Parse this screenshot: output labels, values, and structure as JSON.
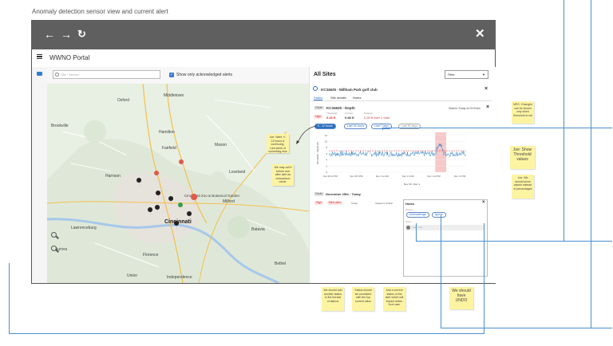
{
  "caption": "Anomaly detection sensor view and current alert",
  "app": {
    "title": "WWNO Portal"
  },
  "search": {
    "placeholder": "Site / Sensor",
    "show_ack_label": "Show only acknowledged alerts"
  },
  "map": {
    "labels": {
      "middletown": "Middletown",
      "oxford": "Oxford",
      "brookville": "Brookville",
      "hamilton": "Hamilton",
      "fairfield": "Fairfield",
      "mason": "Mason",
      "harrison": "Harrison",
      "loveland": "Loveland",
      "milford": "Milford",
      "cincinnati": "Cincinnati",
      "zoo": "Cincinnati Zoo &\nBotanical Garden",
      "lawrenceburg": "Lawrenceburg",
      "batavia": "Batavia",
      "florence": "Florence",
      "bethel": "Bethel",
      "union": "Union",
      "independence": "Independence",
      "aurora": "Aurora"
    }
  },
  "panel": {
    "title": "All Sites",
    "filter": "Filter",
    "site_name": "KC34625 - Millham Park golf club",
    "tabs": [
      "Status",
      "Site details",
      "Notes"
    ],
    "sensor_tag": "Depth",
    "sensor_name": "KC34625 - Depth",
    "started": "Started Today at 09:00am",
    "level_badge": "High",
    "threshold_label": "Threshold",
    "threshold_value": "0.43 ft",
    "current_label": "Current",
    "current_value": "0.68 ft",
    "change_label": "Change",
    "change_value": "0.25 ft over 1 hour",
    "ranges": [
      "6 - 12 hours",
      "Last 24 hours",
      "Last 7 days",
      "Last 30 days"
    ],
    "alert_tag": "Depth",
    "alert_date": "November 25th - Today",
    "alert_badge_high": "High",
    "alert_badge_new": "New alert",
    "alert_when": "Today",
    "alert_status": "Viewed in Portal"
  },
  "notes_panel": {
    "title": "Notes",
    "actions_label": "Actions",
    "ack_button": "Acknowledge",
    "ignore_button": "Ignore",
    "notes_label": "Notes",
    "add_note_placeholder": "Add note..."
  },
  "chart_data": {
    "type": "line",
    "ylabel": "KC34625 - Depth (ft)",
    "xlabel": "Nov 30 - Dec 1",
    "y_ticks": [
      "12",
      "10",
      "8",
      "6",
      "4",
      "2",
      "0"
    ],
    "x_ticks": [
      "Nov 30 12 PM",
      "Nov 30 6 PM",
      "Dec 1 12 AM",
      "Dec 1 6 AM",
      "Dec 1 12 PM",
      "Dec 1 6 PM"
    ],
    "ylim": [
      0,
      13
    ],
    "threshold": 7,
    "highlight_start": 0.775,
    "highlight_end": 0.855,
    "baseline": 6,
    "noise": 0.9,
    "spike_level": 9,
    "color_line": "#2d7fc5",
    "color_threshold": "#e05a5a",
    "color_highlight": "#f6c8c8"
  },
  "stickies": {
    "joe_comment": "Joe: Want +/- 12 hours & continuing. Last week of something else",
    "may_call": "We may call it before and after alert as comparison mode.",
    "mrc_changes": "MRC: Changes can be shown only when threshold is set",
    "show_threshold": "Joe: Show Threshold values",
    "joe_should": "Joe: We should show values instead of percentages",
    "add_status": "We should add another status in the list last of alarms",
    "status_consistent": "Status should be consistent with the top current value",
    "add_current": "Add a current status of the alert which will impact action from user",
    "undo": "We should have UNDO"
  },
  "colors": {
    "chrome": "#5f5f5f",
    "accent": "#2d6fc0",
    "sticky": "#fdf4a2",
    "alert_red": "#e05a5a"
  }
}
